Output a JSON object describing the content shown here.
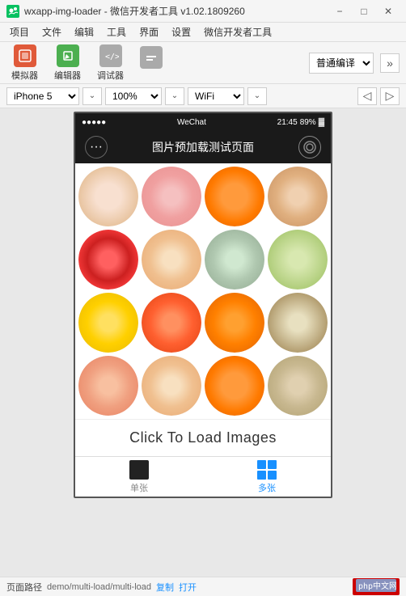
{
  "window": {
    "title": "wxapp-img-loader - 微信开发者工具 v1.02.1809260",
    "minimize_label": "−",
    "restore_label": "□",
    "close_label": "✕"
  },
  "menu": {
    "items": [
      "项目",
      "文件",
      "编辑",
      "工具",
      "界面",
      "设置",
      "微信开发者工具"
    ]
  },
  "toolbar": {
    "simulator_label": "模拟器",
    "editor_label": "编辑器",
    "debugger_label": "调试器",
    "encoding_placeholder": "普通编译",
    "more_label": "»"
  },
  "device_bar": {
    "device": "iPhone 5",
    "zoom": "100%",
    "network": "WiFi"
  },
  "phone": {
    "status_left": "●●●●●",
    "status_center": "WeChat",
    "status_time": "21:45",
    "status_battery": "89%",
    "nav_title": "图片预加载测试页面",
    "nav_dots": "···",
    "grid_items": [
      {
        "class": "f1"
      },
      {
        "class": "f2"
      },
      {
        "class": "f3"
      },
      {
        "class": "f4"
      },
      {
        "class": "f5"
      },
      {
        "class": "f6"
      },
      {
        "class": "f7"
      },
      {
        "class": "f8"
      },
      {
        "class": "f9"
      },
      {
        "class": "f10"
      },
      {
        "class": "f11"
      },
      {
        "class": "f12"
      },
      {
        "class": "f13"
      },
      {
        "class": "f14"
      },
      {
        "class": "f15"
      },
      {
        "class": "f16"
      }
    ],
    "load_btn_label": "Click To Load Images",
    "tab_single_label": "单张",
    "tab_multi_label": "多张"
  },
  "status_bar": {
    "label": "页面路径",
    "path": "demo/multi-load/multi-load",
    "copy_label": "复制",
    "open_label": "打开"
  }
}
